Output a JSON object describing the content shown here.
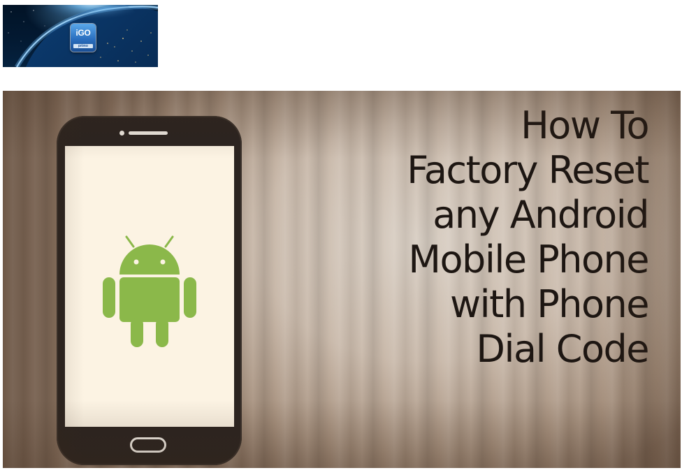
{
  "logo": {
    "badge_text": "iGO",
    "badge_sub": "primo",
    "icon": "globe-icon"
  },
  "hero": {
    "headline_lines": [
      "How To",
      "Factory Reset",
      "any Android",
      "Mobile Phone",
      "with Phone",
      "Dial Code"
    ],
    "icons": [
      "smartphone-icon",
      "android-icon"
    ],
    "colors": {
      "android_green": "#8bb84a",
      "phone_body": "#2b2420",
      "screen": "#fcf3e3",
      "text": "#1d1612"
    }
  }
}
